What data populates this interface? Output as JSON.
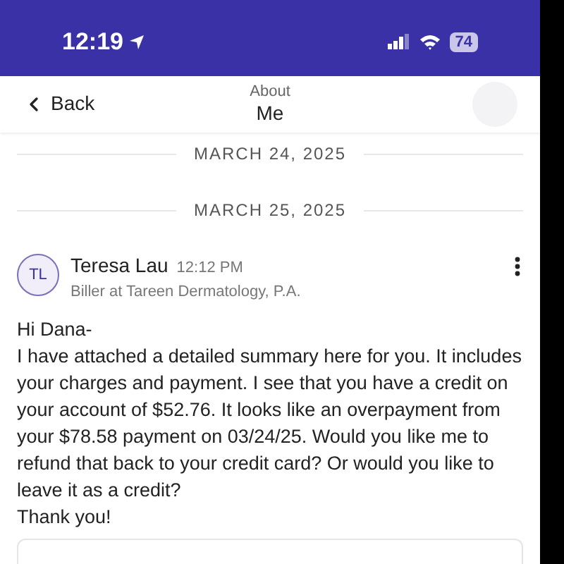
{
  "status_bar": {
    "time": "12:19",
    "battery": "74"
  },
  "header": {
    "back": "Back",
    "title_top": "About",
    "title_bottom": "Me"
  },
  "date_dividers": [
    "MARCH 24, 2025",
    "MARCH 25, 2025"
  ],
  "message": {
    "initials": "TL",
    "sender": "Teresa Lau",
    "time": "12:12 PM",
    "role": "Biller at Tareen Dermatology, P.A.",
    "lines": [
      "Hi Dana-",
      "I have attached a detailed summary here for you. It includes your charges and payment. I see that you have a credit on your account of $52.76. It looks like an overpayment from your $78.58 payment on 03/24/25. Would you like me to refund that back to your credit card? Or would you like to leave it as a credit?",
      "Thank you!"
    ]
  }
}
